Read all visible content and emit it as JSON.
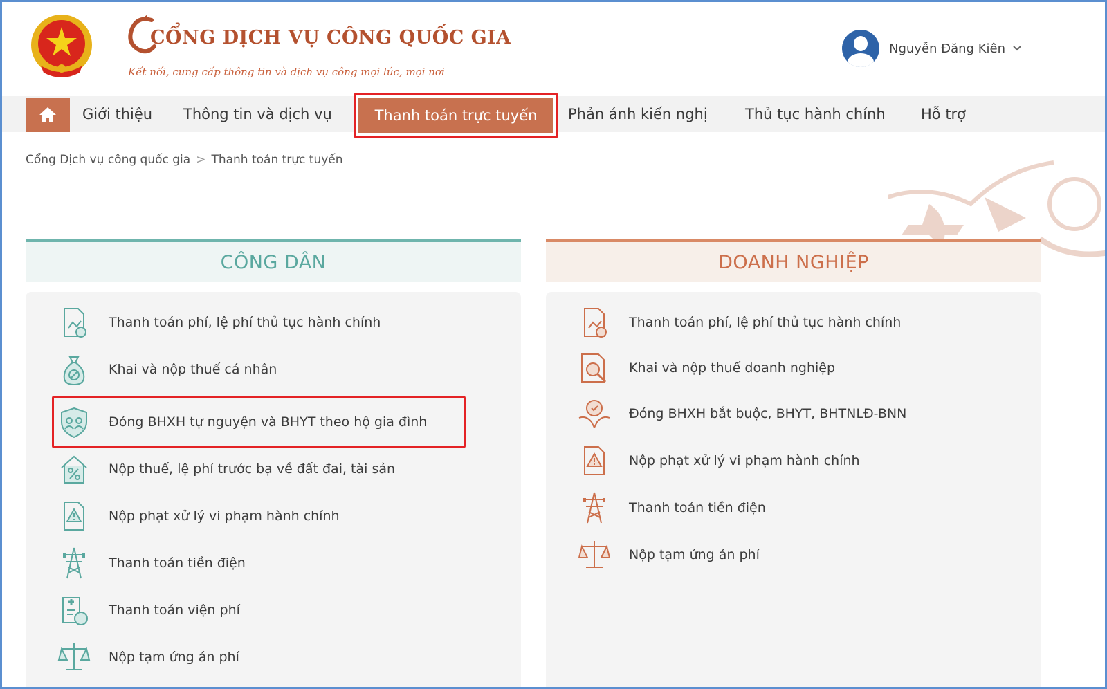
{
  "header": {
    "title": "CỔNG DỊCH VỤ CÔNG QUỐC GIA",
    "subtitle": "Kết nối, cung cấp thông tin và dịch vụ công mọi lúc, mọi nơi",
    "user_name": "Nguyễn Đăng Kiên"
  },
  "nav": {
    "items": [
      "Giới thiệu",
      "Thông tin và dịch vụ",
      "Thanh toán trực tuyến",
      "Phản ánh kiến nghị",
      "Thủ tục hành chính",
      "Hỗ trợ"
    ],
    "active_index": 2
  },
  "breadcrumb": {
    "items": [
      "Cổng Dịch vụ công quốc gia",
      "Thanh toán trực tuyến"
    ],
    "separator": ">"
  },
  "columns": {
    "citizen": {
      "title": "CÔNG DÂN",
      "items": [
        {
          "label": "Thanh toán phí, lệ phí thủ tục hành chính",
          "icon": "fee-document-icon"
        },
        {
          "label": "Khai và nộp thuế cá nhân",
          "icon": "money-bag-icon"
        },
        {
          "label": "Đóng BHXH tự nguyện và BHYT theo hộ gia đình",
          "icon": "family-shield-icon"
        },
        {
          "label": "Nộp thuế, lệ phí trước bạ về đất đai, tài sản",
          "icon": "house-percent-icon"
        },
        {
          "label": "Nộp phạt xử lý vi phạm hành chính",
          "icon": "warning-document-icon"
        },
        {
          "label": "Thanh toán tiền điện",
          "icon": "power-tower-icon"
        },
        {
          "label": "Thanh toán viện phí",
          "icon": "hospital-bill-icon"
        },
        {
          "label": "Nộp tạm ứng án phí",
          "icon": "scale-icon"
        }
      ],
      "highlighted_index": 2
    },
    "business": {
      "title": "DOANH NGHIỆP",
      "items": [
        {
          "label": "Thanh toán phí, lệ phí thủ tục hành chính",
          "icon": "fee-document-icon"
        },
        {
          "label": "Khai và nộp thuế doanh nghiệp",
          "icon": "tax-search-icon"
        },
        {
          "label": "Đóng BHXH bắt buộc, BHYT, BHTNLĐ-BNN",
          "icon": "hands-shield-icon"
        },
        {
          "label": "Nộp phạt xử lý vi phạm hành chính",
          "icon": "warning-document-icon"
        },
        {
          "label": "Thanh toán tiền điện",
          "icon": "power-tower-icon"
        },
        {
          "label": "Nộp tạm ứng án phí",
          "icon": "scale-icon"
        }
      ]
    }
  },
  "colors": {
    "brand": "#b4512f",
    "nav_active": "#c8714f",
    "citizen_accent": "#5aa89f",
    "business_accent": "#cc6f4b",
    "highlight_border": "#e42225"
  }
}
